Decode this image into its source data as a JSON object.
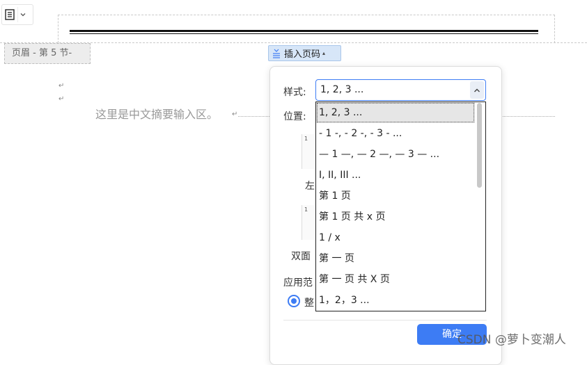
{
  "toolbar": {
    "tool_icon": "document-layout-icon",
    "tool_dropdown_icon": "chevron-down-icon"
  },
  "header": {
    "tag_label": "页眉  - 第 5 节-",
    "insert_page_number_label": "插入页码",
    "insert_icon": "page-number-icon",
    "insert_caret": "▴"
  },
  "body": {
    "para_mark": "↵",
    "abstract_text": "这里是中文摘要输入区。"
  },
  "dialog": {
    "style_label": "样式:",
    "style_value": "1, 2, 3 ...",
    "position_label": "位置:",
    "thumb_number": "1",
    "left_label": "左",
    "double_label": "双面",
    "scope_label": "应用范",
    "scope_option": "整",
    "ok_label": "确定",
    "style_options": [
      "1, 2, 3 ...",
      "- 1 -, - 2 -, - 3 - ...",
      "— 1 —, — 2 —, — 3 — ...",
      "I, II, III ...",
      "第 1 页",
      "第 1 页 共 x 页",
      "1 / x",
      "第 一 页",
      "第 一 页 共 X 页",
      "1，2，3 ..."
    ],
    "selected_index": 0
  },
  "watermark": "CSDN @萝卜变潮人",
  "colors": {
    "accent": "#3d7cf4",
    "highlight": "#d7e6f8"
  }
}
